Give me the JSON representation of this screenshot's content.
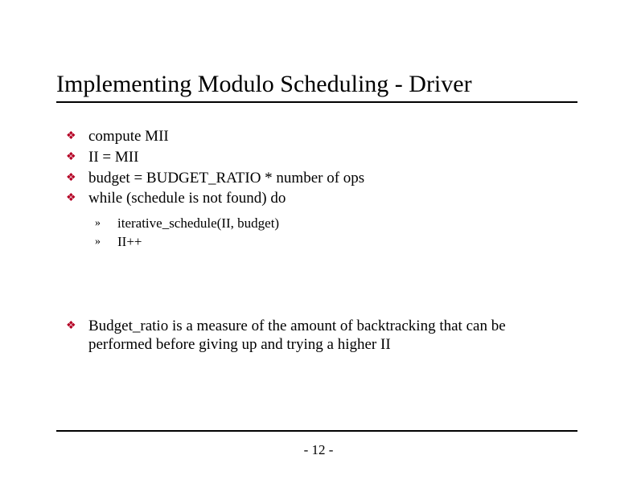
{
  "title": "Implementing Modulo Scheduling - Driver",
  "bullets_top": [
    "compute MII",
    "II = MII",
    "budget = BUDGET_RATIO * number of ops",
    "while (schedule is not found) do"
  ],
  "sub_bullets": [
    "iterative_schedule(II, budget)",
    "II++"
  ],
  "bullets_bottom": [
    "Budget_ratio is a measure of the amount of backtracking that can be performed before giving up and trying a higher II"
  ],
  "page_number": "- 12 -",
  "markers": {
    "level1": "❖",
    "level2": "»"
  }
}
